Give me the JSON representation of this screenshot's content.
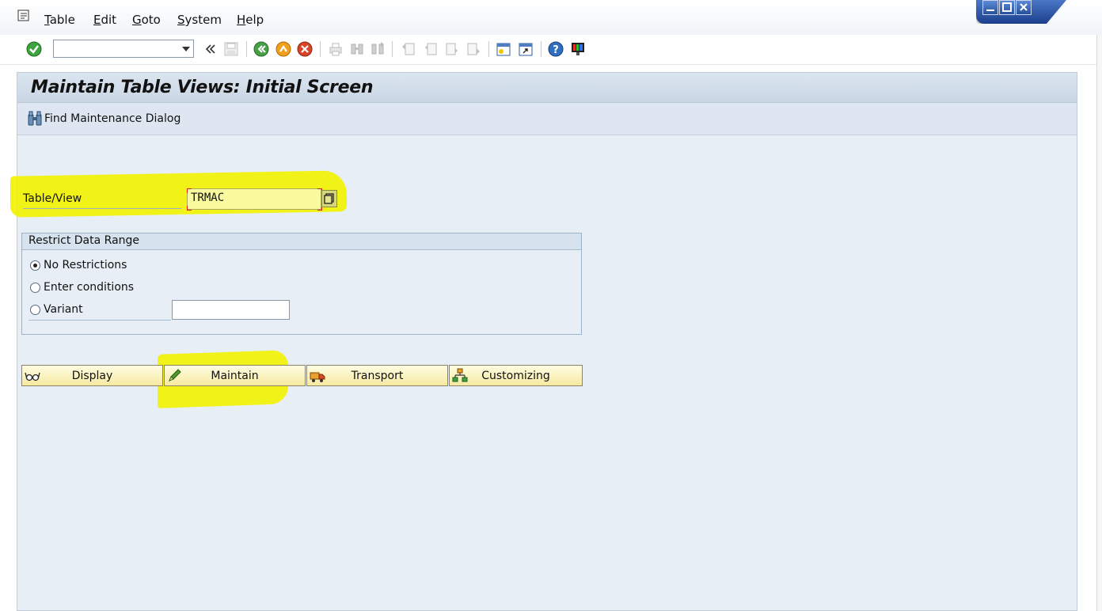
{
  "menu": {
    "items": [
      "Table",
      "Edit",
      "Goto",
      "System",
      "Help"
    ]
  },
  "toolbar": {
    "command_value": "",
    "icons": [
      "enter-check-icon",
      "back-double-icon",
      "save-icon",
      "back-icon",
      "exit-icon",
      "cancel-icon",
      "print-icon",
      "find-icon",
      "find-next-icon",
      "first-page-icon",
      "prev-page-icon",
      "next-page-icon",
      "last-page-icon",
      "new-session-icon",
      "shortcut-icon",
      "help-icon",
      "layout-icon"
    ]
  },
  "screen": {
    "title": "Maintain Table Views: Initial Screen",
    "find_dialog_label": "Find Maintenance Dialog"
  },
  "table_view": {
    "label": "Table/View",
    "value": "TRMAC"
  },
  "restrict": {
    "title": "Restrict Data Range",
    "options": [
      {
        "label": "No Restrictions",
        "selected": true
      },
      {
        "label": "Enter conditions",
        "selected": false
      },
      {
        "label": "Variant",
        "selected": false
      }
    ],
    "variant_value": ""
  },
  "actions": {
    "display": "Display",
    "maintain": "Maintain",
    "transport": "Transport",
    "customizing": "Customizing"
  },
  "colors": {
    "highlight": "#f2f200",
    "button_fill": "#f6e9a0",
    "panel_bg": "#e8eef5"
  }
}
